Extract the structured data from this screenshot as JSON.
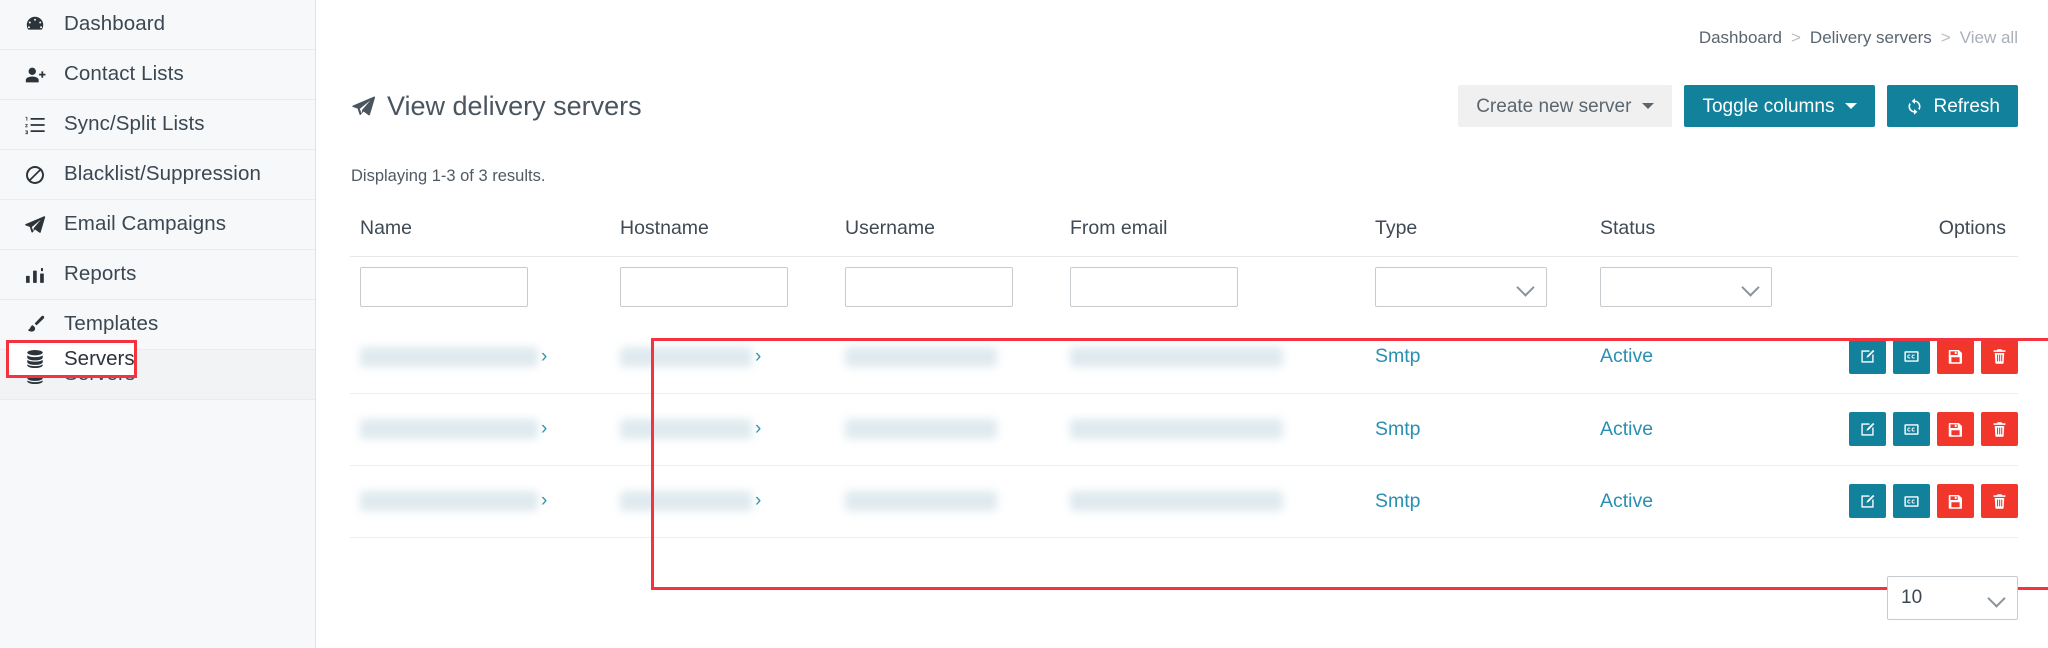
{
  "sidebar": {
    "items": [
      {
        "label": "Dashboard",
        "icon": "dashboard-icon",
        "active": false
      },
      {
        "label": "Contact Lists",
        "icon": "user-plus-icon",
        "active": false
      },
      {
        "label": "Sync/Split Lists",
        "icon": "list-ol-icon",
        "active": false
      },
      {
        "label": "Blacklist/Suppression",
        "icon": "ban-icon",
        "active": false
      },
      {
        "label": "Email Campaigns",
        "icon": "paper-plane-icon",
        "active": false
      },
      {
        "label": "Reports",
        "icon": "bar-chart-icon",
        "active": false
      },
      {
        "label": "Templates",
        "icon": "paint-brush-icon",
        "active": false
      },
      {
        "label": "Servers",
        "icon": "database-icon",
        "active": true
      }
    ],
    "highlighted_item": "Servers"
  },
  "breadcrumb": {
    "items": [
      {
        "label": "Dashboard",
        "current": false
      },
      {
        "label": "Delivery servers",
        "current": false
      },
      {
        "label": "View all",
        "current": true
      }
    ],
    "separator": ">"
  },
  "header": {
    "title": "View delivery servers",
    "title_icon": "paper-plane-icon",
    "buttons": [
      {
        "label": "Create new server",
        "style": "default",
        "caret": true,
        "icon": ""
      },
      {
        "label": "Toggle columns",
        "style": "teal",
        "caret": true,
        "icon": ""
      },
      {
        "label": "Refresh",
        "style": "teal",
        "caret": false,
        "icon": "refresh-icon"
      }
    ]
  },
  "results_summary": "Displaying 1-3 of 3 results.",
  "table": {
    "columns": [
      {
        "key": "name",
        "label": "Name",
        "filter": "text"
      },
      {
        "key": "hostname",
        "label": "Hostname",
        "filter": "text"
      },
      {
        "key": "username",
        "label": "Username",
        "filter": "text"
      },
      {
        "key": "fromemail",
        "label": "From email",
        "filter": "text"
      },
      {
        "key": "type",
        "label": "Type",
        "filter": "select"
      },
      {
        "key": "status",
        "label": "Status",
        "filter": "select"
      },
      {
        "key": "options",
        "label": "Options",
        "filter": "none"
      }
    ],
    "filters": {
      "name": "",
      "hostname": "",
      "username": "",
      "fromemail": "",
      "type": "",
      "status": ""
    },
    "rows": [
      {
        "name": "",
        "hostname": "",
        "username": "",
        "fromemail": "",
        "type": "Smtp",
        "status": "Active"
      },
      {
        "name": "",
        "hostname": "",
        "username": "",
        "fromemail": "",
        "type": "Smtp",
        "status": "Active"
      },
      {
        "name": "",
        "hostname": "",
        "username": "",
        "fromemail": "",
        "type": "Smtp",
        "status": "Active"
      }
    ],
    "row_actions": [
      {
        "name": "edit-row-button",
        "icon": "pencil-square-icon",
        "style": "teal"
      },
      {
        "name": "clone-row-button",
        "icon": "cc-box-icon",
        "style": "teal"
      },
      {
        "name": "save-row-button",
        "icon": "floppy-disk-icon",
        "style": "red"
      },
      {
        "name": "delete-row-button",
        "icon": "trash-icon",
        "style": "red"
      }
    ]
  },
  "pagination": {
    "page_size": "10"
  },
  "colors": {
    "teal": "#12829c",
    "link_teal": "#2a8fb0",
    "danger_red": "#f1372c",
    "annotation_red": "#f5333f",
    "sidebar_bg": "#f7f8f9",
    "text": "#3b4752"
  }
}
